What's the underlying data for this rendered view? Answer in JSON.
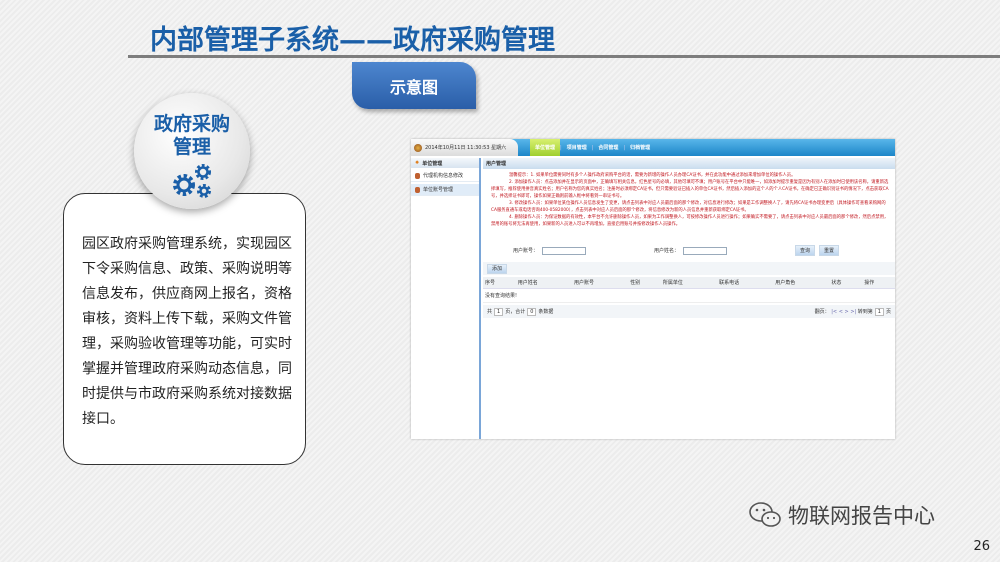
{
  "slide": {
    "title": "内部管理子系统——政府采购管理",
    "tag": "示意图",
    "badge_line1": "政府采购",
    "badge_line2": "管理",
    "description": "园区政府采购管理系统，实现园区下令采购信息、政策、采购说明等信息发布，供应商网上报名，资格审核，资料上传下载，采购文件管理，采购验收管理等功能，可实时掌握并管理政府采购动态信息，同时提供与市政府采购系统对接数据接口。",
    "watermark": "物联网报告中心",
    "page_number": "26"
  },
  "app": {
    "datetime": "2014年10月11日 11:30:53 星期六",
    "tabs": [
      "单位管理",
      "项目管理",
      "合同管理",
      "归档管理"
    ],
    "sidebar": {
      "header": "单位管理",
      "items": [
        "代理机构信息修改",
        "单位账号管理"
      ]
    },
    "panel_title": "用户管理",
    "notice": [
      "温馨提示：1. 如果单位需要同时有多个人操作政府采购平台的话，需要为新增的操作人员办理CA证书，并在此功能中通过添加来增加单位的操作人员。",
      "2. 添加操作人员：点击添加并在显示的页面中，正确填写相关信息，红色星号的必填，其他可填可不填；用户账号在平台中只能唯一，如添加时提示重复是因为有别人在添加时已使用该名称，请重新选择填写，推荐使用拼音真实姓名；用户名称为您的真实姓名；注册时必须绑定CA证书，但只需要验证已插入的单位CA证书，然后插入添加的这个人的个人CA证书，在确定已正确识别证书的情况下，点击获取CA号，并选择证书即可，操作如果正确则前输入框中将看到一串证书号。",
      "3. 修改操作人员：如果单位某位操作人员信息发生了变更，请点击列表中对应人员最后面的那个修改，对信息进行修改；如果是工作调整换人了，请先将CA证书办理变更后（具体操作可查看采购网的CA服务直通车或电话咨询400-0582000），点击列表中对应人员后面的那个修改，将信息修改为新的人员信息并重新获取绑定CA证书。",
      "4. 删除操作人员：为保证数据的有效性，本平台不允许删除操作人员，如果为工作调整换人，可按修改操作人员进行操作；如果确实不需要了，请点击列表中对应人员最后面的那个修改，然后点禁用，禁用的账号将无法再使用，如果新的人员进入可以不再增加，直接启用账号并按修改操作人员操作。"
    ],
    "search": {
      "account_label": "用户账号：",
      "account_value": "",
      "name_label": "用户姓名：",
      "name_value": "",
      "query": "查询",
      "reset": "重置"
    },
    "add": "添加",
    "columns": [
      "序号",
      "用户姓名",
      "用户账号",
      "性别",
      "所属单位",
      "联系电话",
      "用户角色",
      "状态",
      "操作"
    ],
    "empty": "没有查询结果!",
    "pager": {
      "pre": "共",
      "pages": "1",
      "mid": "页，合计",
      "count": "0",
      "post": "条数据",
      "flip": "翻页：",
      "first": "|<",
      "prev": "<",
      "next": ">",
      "last": ">|",
      "goto": "转到第",
      "goto_page": "1",
      "page_unit": "页"
    }
  }
}
